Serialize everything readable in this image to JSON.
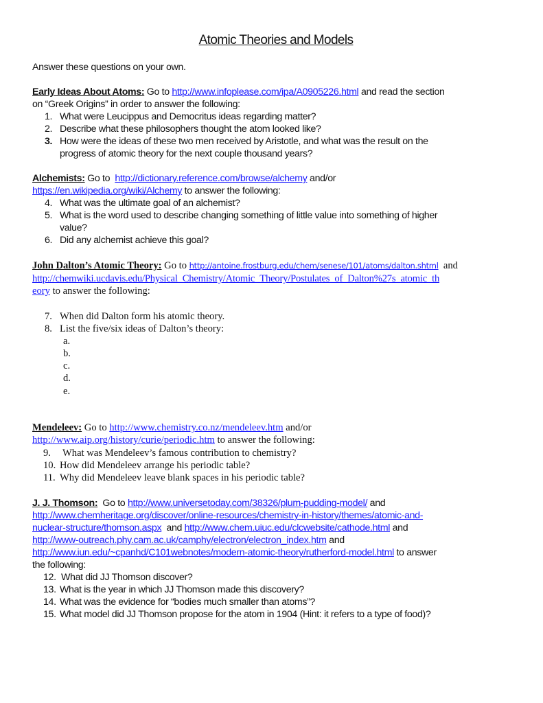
{
  "title": "Atomic Theories and Models",
  "intro": "Answer these questions on your own.",
  "sections": {
    "early": {
      "heading": "Early Ideas About Atoms:",
      "pre": " Go to ",
      "link1": "http://www.infoplease.com/ipa/A0905226.html",
      "post1": " and read the section",
      "line2": "on “Greek Origins” in order to answer the following:",
      "questions": [
        {
          "num": "1.",
          "text": "What were Leucippus and Democritus ideas regarding matter?"
        },
        {
          "num": "2.",
          "text": "Describe what these philosophers thought the atom looked like?"
        },
        {
          "num": "3.",
          "text": "How were the ideas of these two men received by Aristotle, and what was the result on the",
          "cont": "progress of atomic theory for the next couple thousand years?"
        }
      ]
    },
    "alchemists": {
      "heading": "Alchemists:",
      "pre": " Go to  ",
      "link1": "http://dictionary.reference.com/browse/alchemy",
      "mid": " and/or",
      "link2": "https://en.wikipedia.org/wiki/Alchemy",
      "post": " to answer the following:",
      "questions": [
        {
          "num": "4.",
          "text": "What was the ultimate goal of an alchemist?"
        },
        {
          "num": "5.",
          "text": "What is the word used to describe changing something of little value into something of higher",
          "cont": "value?"
        },
        {
          "num": "6.",
          "text": "Did any alchemist achieve this goal?"
        }
      ]
    },
    "dalton": {
      "heading": "John Dalton’s Atomic Theory:",
      "pre": " Go to ",
      "link1": "http://antoine.frostburg.edu/chem/senese/101/atoms/dalton.shtml",
      "mid": "  and",
      "link2a": "http://chemwiki.ucdavis.edu/Physical_Chemistry/Atomic_Theory/Postulates_of_Dalton%27s_atomic_th",
      "link2b": "eory",
      "post": " to answer the following:",
      "questions": [
        {
          "num": "7.",
          "text": "When did Dalton form his atomic theory."
        },
        {
          "num": "8.",
          "text": "List the five/six ideas of Dalton’s theory:"
        }
      ],
      "subitems": [
        "a.",
        "b.",
        "c.",
        "d.",
        "e."
      ]
    },
    "mendeleev": {
      "heading": "Mendeleev:",
      "pre": " Go to ",
      "link1": "http://www.chemistry.co.nz/mendeleev.htm",
      "mid": " and/or",
      "link2": "http://www.aip.org/history/curie/periodic.htm",
      "post": " to answer the following:",
      "questions": [
        {
          "num": "9.",
          "text": "What was Mendeleev’s famous contribution to chemistry?"
        },
        {
          "num": "10.",
          "text": "How did Mendeleev arrange his periodic table?"
        },
        {
          "num": "11.",
          "text": "Why did Mendeleev leave blank spaces in his periodic table?"
        }
      ]
    },
    "thomson": {
      "heading": "J. J. Thomson:",
      "pre": "  Go to ",
      "link1": "http://www.universetoday.com/38326/plum-pudding-model/",
      "mid1": " and",
      "link2a": "http://www.chemheritage.org/discover/online-resources/chemistry-in-history/themes/atomic-and-",
      "link2b": "nuclear-structure/thomson.aspx",
      "mid2": "  and ",
      "link3": "http://www.chem.uiuc.edu/clcwebsite/cathode.html",
      "mid3": " and",
      "link4": "http://www-outreach.phy.cam.ac.uk/camphy/electron/electron_index.htm",
      "mid4": " and",
      "link5": "http://www.iun.edu/~cpanhd/C101webnotes/modern-atomic-theory/rutherford-model.html",
      "post5": " to answer",
      "post6": "the following:",
      "questions": [
        {
          "num": "12.",
          "text": "What did JJ Thomson discover?"
        },
        {
          "num": "13.",
          "text": "What is the year in which JJ Thomson made this discovery?"
        },
        {
          "num": "14.",
          "text": "What was the evidence for “bodies much smaller than atoms”?"
        },
        {
          "num": "15.",
          "text": "What model did JJ Thomson propose for the atom in 1904 (Hint: it refers to a type of food)?"
        }
      ]
    }
  },
  "colors": {
    "link": "#1a1aff",
    "text": "#111111"
  }
}
